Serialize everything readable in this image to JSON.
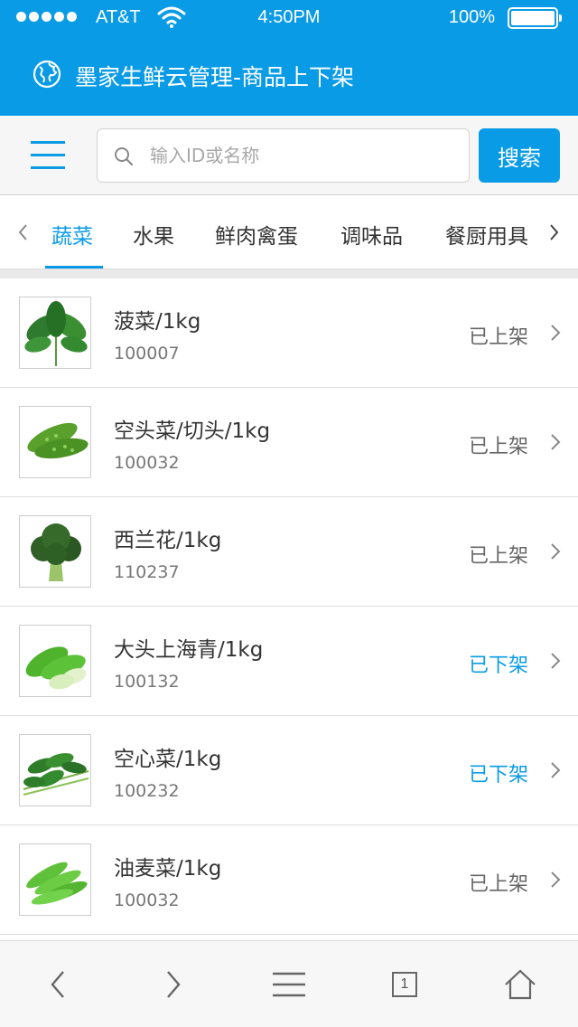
{
  "status_bar": {
    "carrier": "AT&T",
    "time": "4:50PM",
    "battery": "100%"
  },
  "header": {
    "title": "墨家生鲜云管理-商品上下架"
  },
  "search": {
    "placeholder": "输入ID或名称",
    "button_label": "搜索"
  },
  "categories": [
    {
      "label": "蔬菜",
      "active": true
    },
    {
      "label": "水果",
      "active": false
    },
    {
      "label": "鲜肉禽蛋",
      "active": false
    },
    {
      "label": "调味品",
      "active": false
    },
    {
      "label": "餐厨用具",
      "active": false
    }
  ],
  "products": [
    {
      "name": "菠菜/1kg",
      "id": "100007",
      "status": "已上架",
      "image": "spinach",
      "listed": true
    },
    {
      "name": "空头菜/切头/1kg",
      "id": "100032",
      "status": "已上架",
      "image": "bitter-melon",
      "listed": true
    },
    {
      "name": "西兰花/1kg",
      "id": "110237",
      "status": "已上架",
      "image": "broccoli",
      "listed": true
    },
    {
      "name": "大头上海青/1kg",
      "id": "100132",
      "status": "已下架",
      "image": "bok-choy",
      "listed": false
    },
    {
      "name": "空心菜/1kg",
      "id": "100232",
      "status": "已下架",
      "image": "water-spinach",
      "listed": false
    },
    {
      "name": "油麦菜/1kg",
      "id": "100032",
      "status": "已上架",
      "image": "lettuce",
      "listed": true
    }
  ],
  "toolbar": {
    "tab_count": "1"
  },
  "colors": {
    "accent": "#0a9be6",
    "listed_status": "#666666",
    "unlisted_status": "#0a9be6"
  }
}
